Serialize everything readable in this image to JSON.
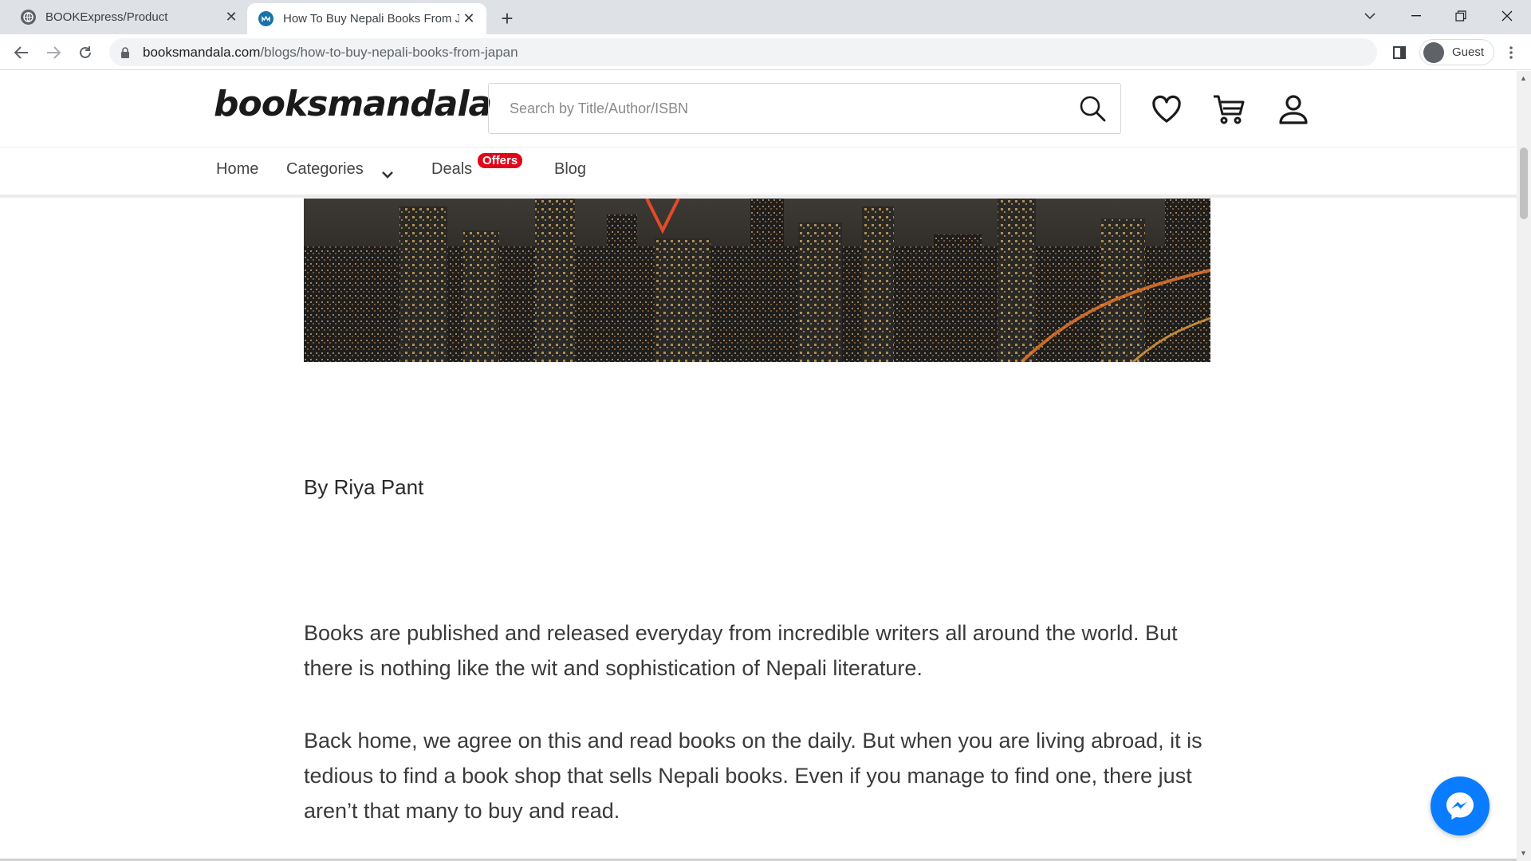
{
  "browser": {
    "tabs": [
      {
        "title": "BOOKExpress/Product",
        "active": false,
        "favicon": "globe-icon"
      },
      {
        "title": "How To Buy Nepali Books From J",
        "active": true,
        "favicon": "booksmandala-favicon"
      }
    ],
    "url_host": "booksmandala.com",
    "url_path": "/blogs/how-to-buy-nepali-books-from-japan",
    "profile_label": "Guest"
  },
  "site": {
    "logo_text": "booksmandala",
    "search_placeholder": "Search by Title/Author/ISBN",
    "nav": {
      "home": "Home",
      "categories": "Categories",
      "deals": "Deals",
      "deals_badge": "Offers",
      "blog": "Blog"
    },
    "accent_color": "#e0071b"
  },
  "article": {
    "author": "By Riya Pant",
    "paragraphs": [
      "Books are published and released everyday from incredible writers all around the world. But there is nothing like the wit and sophistication of Nepali literature.",
      "Back home, we agree on this and read books on the daily. But when you are living abroad, it is tedious to find a book shop that sells Nepali books. Even if you manage to find one, there just aren’t that many to buy and read."
    ]
  },
  "chat_widget": {
    "icon": "messenger-icon",
    "color": "#0a7cff"
  }
}
